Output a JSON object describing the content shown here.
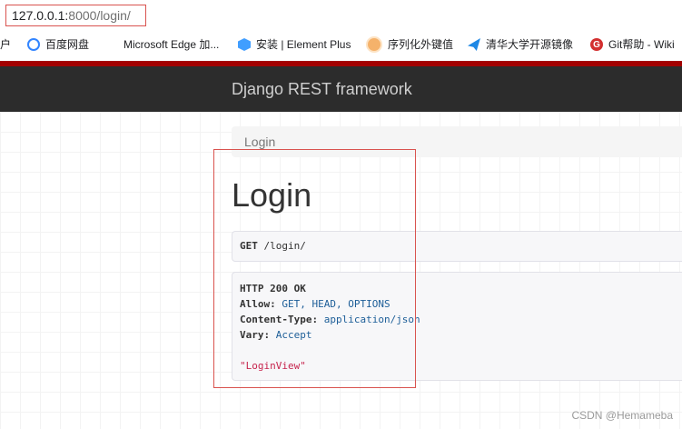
{
  "browser": {
    "url_host": "127.0.0.1:",
    "url_path": "8000/login/",
    "bookmarks": [
      {
        "label": "户",
        "icon": "none"
      },
      {
        "label": "百度网盘",
        "icon": "baidu-netdisk-icon"
      },
      {
        "label": "Microsoft Edge 加...",
        "icon": "microsoft-icon"
      },
      {
        "label": "安装 | Element Plus",
        "icon": "element-plus-icon"
      },
      {
        "label": "序列化外键值",
        "icon": "bookmark-icon"
      },
      {
        "label": "清华大学开源镜像",
        "icon": "tsinghua-icon"
      },
      {
        "label": "Git帮助 - Wiki",
        "icon": "git-icon"
      }
    ]
  },
  "drf": {
    "brand": "Django REST framework",
    "breadcrumb": "Login",
    "title": "Login",
    "request": {
      "method": "GET",
      "path": "/login/"
    },
    "response": {
      "status": "HTTP 200 OK",
      "headers": [
        {
          "name": "Allow:",
          "value": "GET, HEAD, OPTIONS"
        },
        {
          "name": "Content-Type:",
          "value": "application/json"
        },
        {
          "name": "Vary:",
          "value": "Accept"
        }
      ],
      "body": "\"LoginView\""
    }
  },
  "watermark": "CSDN @Hemameba",
  "colors": {
    "navbar": "#2c2c2c",
    "accent_red": "#a30000",
    "header_value": "#1d5e98",
    "string_value": "#c7254e"
  }
}
